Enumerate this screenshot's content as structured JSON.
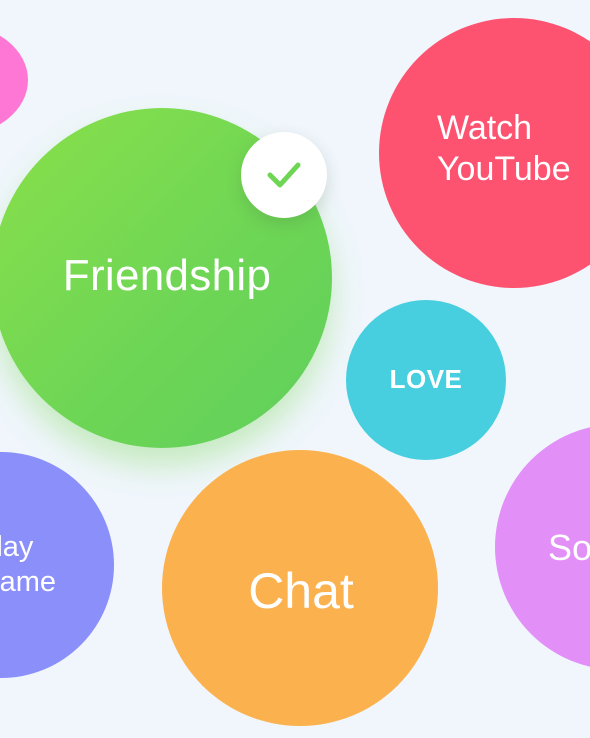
{
  "bubbles": {
    "pink": {
      "label": "",
      "selected": false,
      "color": "#ff77d4"
    },
    "friendship": {
      "label": "Friendship",
      "selected": true,
      "color": "#6fd655"
    },
    "watch": {
      "label": "Watch\nYouTube",
      "selected": false,
      "color": "#fd5371"
    },
    "love": {
      "label": "LOVE",
      "selected": false,
      "color": "#47cfe0"
    },
    "play": {
      "label": "Play\nGame",
      "selected": false,
      "color": "#8a8ffa"
    },
    "chat": {
      "label": "Chat",
      "selected": false,
      "color": "#fcb14f"
    },
    "social": {
      "label": "Social",
      "selected": false,
      "color": "#e38ff8"
    }
  },
  "selected_badge": {
    "icon": "checkmark-icon",
    "color": "#6fd655"
  },
  "colors": {
    "background": "#f0f6fc",
    "text": "#ffffff"
  }
}
